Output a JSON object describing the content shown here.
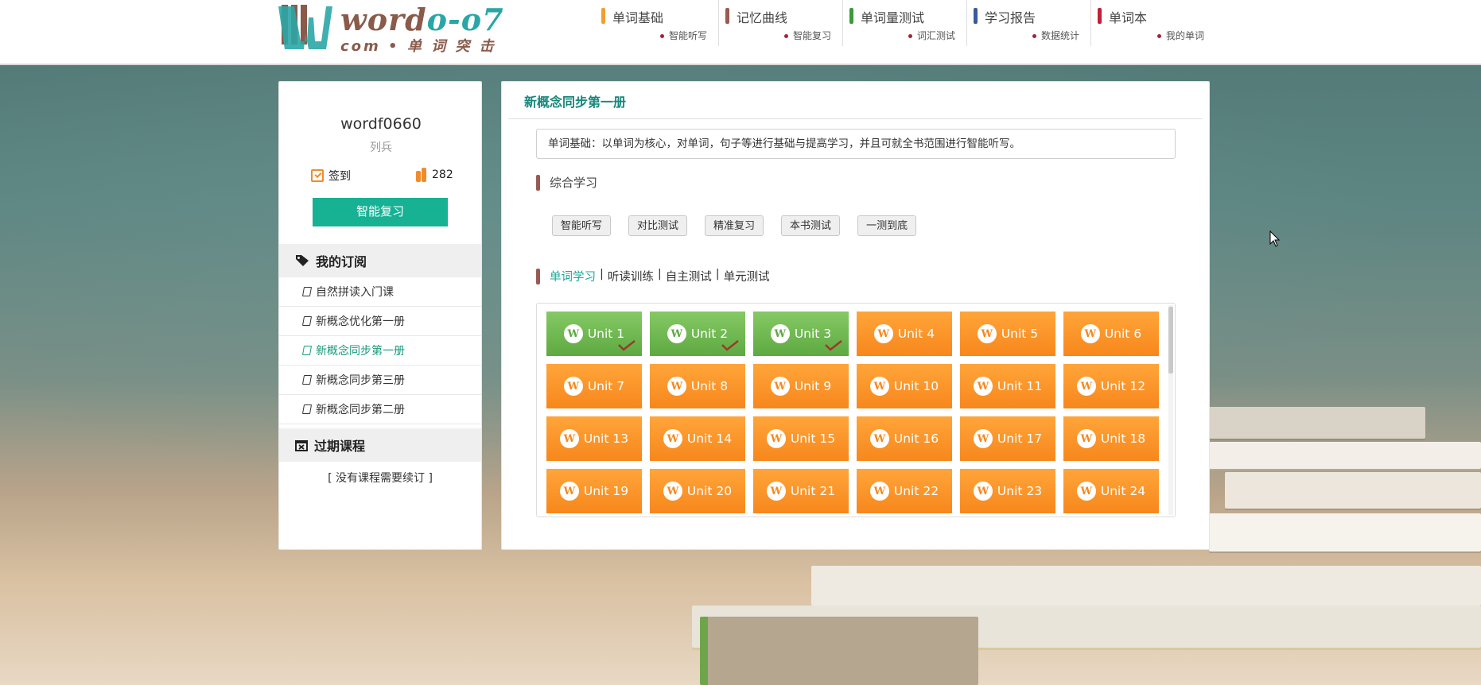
{
  "header": {
    "logo": {
      "brand_main": "word",
      "brand_accent": "o-o7",
      "subtitle": "com • 单 词 突 击"
    },
    "nav": [
      {
        "label": "单词基础",
        "sub": "智能听写",
        "color": "#f0a030"
      },
      {
        "label": "记忆曲线",
        "sub": "智能复习",
        "color": "#9a5a54"
      },
      {
        "label": "单词量测试",
        "sub": "词汇测试",
        "color": "#3a9a3a"
      },
      {
        "label": "学习报告",
        "sub": "数据统计",
        "color": "#3a5a9a"
      },
      {
        "label": "单词本",
        "sub": "我的单词",
        "color": "#c0203a"
      }
    ]
  },
  "user": {
    "name": "wordf0660",
    "rank": "列兵",
    "signin_label": "签到",
    "points": "282",
    "review_button": "智能复习"
  },
  "subscriptions": {
    "title": "我的订阅",
    "items": [
      {
        "label": "自然拼读入门课",
        "active": false
      },
      {
        "label": "新概念优化第一册",
        "active": false
      },
      {
        "label": "新概念同步第一册",
        "active": true
      },
      {
        "label": "新概念同步第三册",
        "active": false
      },
      {
        "label": "新概念同步第二册",
        "active": false
      }
    ]
  },
  "expired": {
    "title": "过期课程",
    "empty_text": "[ 没有课程需要续订 ]"
  },
  "main": {
    "title": "新概念同步第一册",
    "intro": "单词基础：以单词为核心，对单词，句子等进行基础与提高学习，并且可就全书范围进行智能听写。",
    "comprehensive_label": "综合学习",
    "tools": [
      "智能听写",
      "对比测试",
      "精准复习",
      "本书测试",
      "一测到底"
    ],
    "tabs": [
      {
        "label": "单词学习",
        "active": true
      },
      {
        "label": "听读训练",
        "active": false
      },
      {
        "label": "自主测试",
        "active": false
      },
      {
        "label": "单元测试",
        "active": false
      }
    ],
    "tab_separator": "|",
    "unit_logo_letter": "W",
    "units": [
      {
        "label": "Unit 1",
        "done": true
      },
      {
        "label": "Unit 2",
        "done": true
      },
      {
        "label": "Unit 3",
        "done": true
      },
      {
        "label": "Unit 4",
        "done": false
      },
      {
        "label": "Unit 5",
        "done": false
      },
      {
        "label": "Unit 6",
        "done": false
      },
      {
        "label": "Unit 7",
        "done": false
      },
      {
        "label": "Unit 8",
        "done": false
      },
      {
        "label": "Unit 9",
        "done": false
      },
      {
        "label": "Unit 10",
        "done": false
      },
      {
        "label": "Unit 11",
        "done": false
      },
      {
        "label": "Unit 12",
        "done": false
      },
      {
        "label": "Unit 13",
        "done": false
      },
      {
        "label": "Unit 14",
        "done": false
      },
      {
        "label": "Unit 15",
        "done": false
      },
      {
        "label": "Unit 16",
        "done": false
      },
      {
        "label": "Unit 17",
        "done": false
      },
      {
        "label": "Unit 18",
        "done": false
      },
      {
        "label": "Unit 19",
        "done": false
      },
      {
        "label": "Unit 20",
        "done": false
      },
      {
        "label": "Unit 21",
        "done": false
      },
      {
        "label": "Unit 22",
        "done": false
      },
      {
        "label": "Unit 23",
        "done": false
      },
      {
        "label": "Unit 24",
        "done": false
      }
    ]
  },
  "colors": {
    "accent_teal": "#17b194",
    "unit_orange": "#f7871c",
    "unit_green": "#5ea941"
  }
}
